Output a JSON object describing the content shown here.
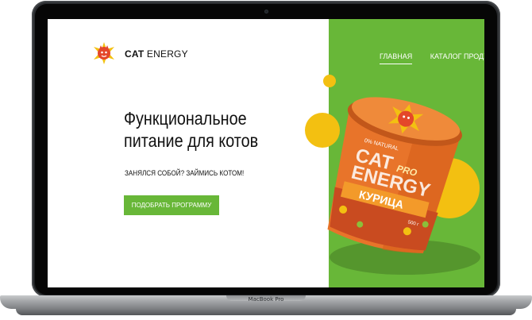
{
  "device": {
    "label": "MacBook Pro"
  },
  "header": {
    "logo_brand": "CAT",
    "logo_brand_light": "ENERGY",
    "nav": [
      {
        "label": "ГЛАВНАЯ",
        "active": true
      },
      {
        "label": "КАТАЛОГ ПРОДУКЦИИ",
        "active": false
      }
    ]
  },
  "hero": {
    "title": "Функциональное питание для котов",
    "subtitle": "ЗАНЯЛСЯ СОБОЙ? ЗАЙМИСЬ КОТОМ!",
    "cta_label": "ПОДОБРАТЬ ПРОГРАММУ"
  },
  "product": {
    "label_natural": "0% NATURAL",
    "brand_line1": "CAT",
    "brand_line2": "ENERGY",
    "brand_pro": "PRO",
    "flavor": "КУРИЦА",
    "weight": "500 г"
  },
  "colors": {
    "accent_green": "#68b738",
    "jar_orange": "#e8742a",
    "yellow": "#f3c011",
    "text_dark": "#111111"
  },
  "icons": {
    "logo": "cat-logo-icon",
    "camera": "camera-icon"
  }
}
